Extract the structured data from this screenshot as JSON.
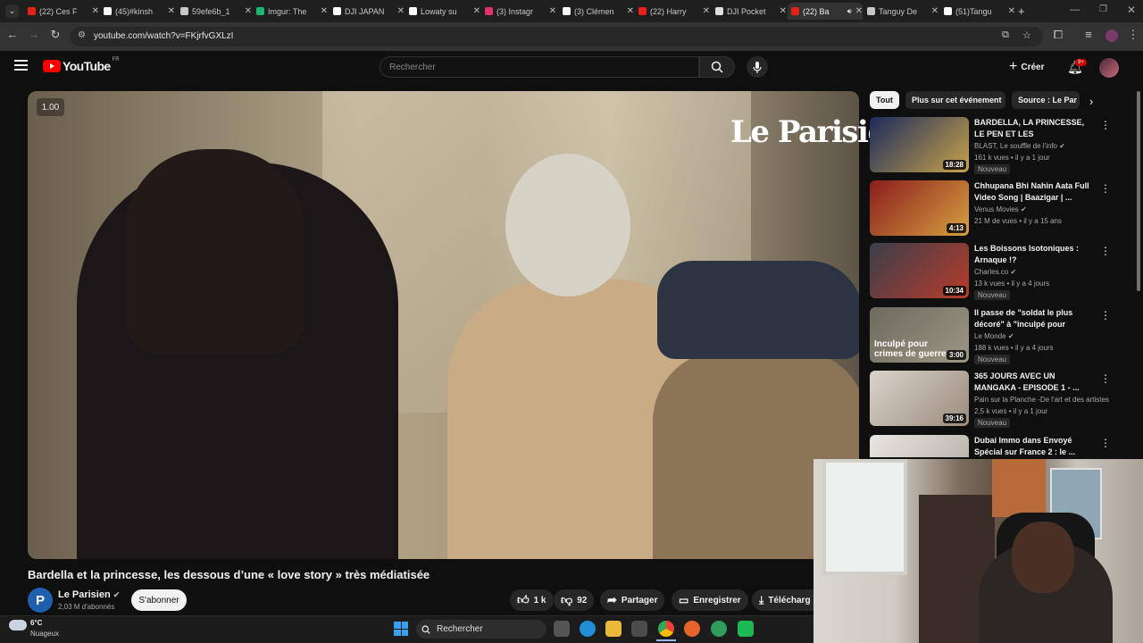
{
  "browser": {
    "tabs": [
      {
        "title": "(22) Ces F",
        "icon": "youtube-icon",
        "color": "#e62117"
      },
      {
        "title": "(45)#kinsh",
        "icon": "tiktok-icon",
        "color": "#ffffff"
      },
      {
        "title": "59efe6b_1",
        "icon": "globe-icon",
        "color": "#c8c8c8"
      },
      {
        "title": "Imgur: The",
        "icon": "imgur-icon",
        "color": "#1bb76e"
      },
      {
        "title": "DJI JAPAN",
        "icon": "x-icon",
        "color": "#ffffff"
      },
      {
        "title": "Lowaty su",
        "icon": "x-icon",
        "color": "#ffffff"
      },
      {
        "title": "(3) Instagr",
        "icon": "instagram-icon",
        "color": "#e1306c"
      },
      {
        "title": "(3) Clémen",
        "icon": "x-icon",
        "color": "#ffffff"
      },
      {
        "title": "(22) Harry",
        "icon": "youtube-icon",
        "color": "#e62117"
      },
      {
        "title": "DJI Pocket",
        "icon": "page-icon",
        "color": "#dddddd"
      },
      {
        "title": "(22) Ba",
        "icon": "youtube-icon",
        "color": "#e62117"
      },
      {
        "title": "Tanguy De",
        "icon": "globe-icon",
        "color": "#c8c8c8"
      },
      {
        "title": "(51)Tangu",
        "icon": "tiktok-icon",
        "color": "#ffffff"
      }
    ],
    "url": "youtube.com/watch?v=FKjrfvGXLzI"
  },
  "youtube": {
    "logo_text": "YouTube",
    "logo_region": "FR",
    "search_placeholder": "Rechercher",
    "create_label": "Créer",
    "notif_count": "9+"
  },
  "video": {
    "speed": "1.00",
    "watermark": "Le Parisien",
    "title": "Bardella et la princesse, les dessous d’une « love story » très médiatisée",
    "channel": "Le Parisien",
    "channel_initial": "P",
    "subscribers": "2,03 M d'abonnés",
    "subscribe_label": "S'abonner",
    "likes": "1 k",
    "dislikes": "92",
    "share_label": "Partager",
    "save_label": "Enregistrer",
    "download_label": "Télécharg"
  },
  "chips": [
    {
      "label": "Tout",
      "selected": true
    },
    {
      "label": "Plus sur cet événement",
      "selected": false
    },
    {
      "label": "Source : Le Par",
      "selected": false
    }
  ],
  "recommendations": [
    {
      "title": "BARDELLA, LA PRINCESSE, LE PEN ET LES MILLIARDAIRES : ...",
      "channel": "BLAST, Le souffle de l'info",
      "meta": "161 k vues • il y a 1 jour",
      "duration": "18:28",
      "badge": "Nouveau",
      "thumb": [
        "#1c2a5c",
        "#c7a34a"
      ]
    },
    {
      "title": "Chhupana Bhi Nahin Aata Full Video Song | Baazigar | ...",
      "channel": "Venus Movies",
      "meta": "21 M de vues • il y a 15 ans",
      "duration": "4:13",
      "badge": "",
      "thumb": [
        "#8a1d1d",
        "#d6a040"
      ]
    },
    {
      "title": "Les Boissons Isotoniques : Arnaque !?",
      "channel": "Charles.co",
      "meta": "13 k vues • il y a 4 jours",
      "duration": "10:34",
      "badge": "Nouveau",
      "thumb": [
        "#3a3f4a",
        "#b73b2b"
      ]
    },
    {
      "title": "Il passe de \"soldat le plus décoré\" à \"inculpé pour crimes...",
      "channel": "Le Monde",
      "meta": "188 k vues • il y a 4 jours",
      "duration": "3:00",
      "badge": "Nouveau",
      "thumb": [
        "#6d6a5e",
        "#9c9784"
      ]
    },
    {
      "title": "365 JOURS AVEC UN MANGAKA - EPISODE 1 - ...",
      "channel": "Pain sur la Planche -De l'art et des artistes",
      "meta": "2,5 k vues • il y a 1 jour",
      "duration": "39:16",
      "badge": "Nouveau",
      "thumb": [
        "#d9d4cc",
        "#9a8b7c"
      ]
    },
    {
      "title": "Dubai Immo dans Envoyé Spécial sur France 2 : le ...",
      "channel": "",
      "meta": "",
      "duration": "",
      "badge": "",
      "thumb": [
        "#e8e6e0",
        "#b0aaa0"
      ]
    }
  ],
  "thumb_captions": {
    "rec4": "Inculpé pour crimes de guerre"
  },
  "taskbar": {
    "weather_temp": "6°C",
    "weather_label": "Nuageux",
    "search_placeholder": "Rechercher"
  }
}
